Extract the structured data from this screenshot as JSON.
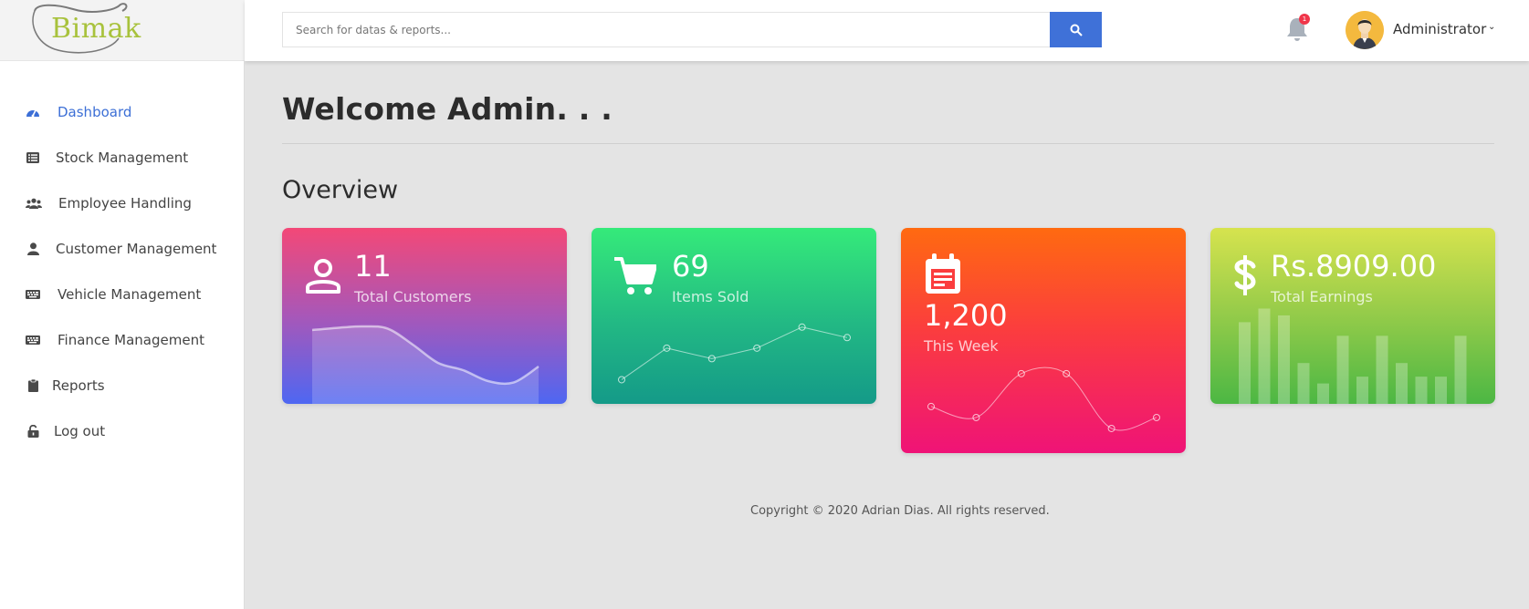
{
  "brand": {
    "logo_text": "Bimak"
  },
  "header": {
    "search_placeholder": "Search for datas & reports...",
    "notification_count": "1",
    "user_name": "Administrator"
  },
  "sidebar": {
    "items": [
      {
        "label": "Dashboard",
        "icon": "dashboard-icon",
        "active": true
      },
      {
        "label": "Stock Management",
        "icon": "list-icon",
        "active": false
      },
      {
        "label": "Employee Handling",
        "icon": "users-icon",
        "active": false
      },
      {
        "label": "Customer Management",
        "icon": "user-icon",
        "active": false
      },
      {
        "label": "Vehicle Management",
        "icon": "keyboard-icon",
        "active": false
      },
      {
        "label": "Finance Management",
        "icon": "keyboard-icon",
        "active": false
      },
      {
        "label": "Reports",
        "icon": "clipboard-icon",
        "active": false
      },
      {
        "label": "Log out",
        "icon": "unlock-icon",
        "active": false
      }
    ]
  },
  "main": {
    "welcome": "Welcome Admin. . .",
    "overview": "Overview"
  },
  "cards": [
    {
      "value": "11",
      "label": "Total Customers",
      "icon": "user-icon",
      "colors": [
        "#f34877",
        "#4e67f2"
      ]
    },
    {
      "value": "69",
      "label": "Items Sold",
      "icon": "cart-icon",
      "colors": [
        "#35ea7a",
        "#149a88"
      ]
    },
    {
      "value": "1,200",
      "label": "This Week",
      "icon": "calendar-icon",
      "colors": [
        "#ff6a10",
        "#ef1377"
      ]
    },
    {
      "value": "Rs.8909.00",
      "label": "Total Earnings",
      "icon": "dollar-icon",
      "colors": [
        "#d6e34e",
        "#4cb744"
      ]
    }
  ],
  "chart_data": [
    {
      "type": "area",
      "series": [
        {
          "values": [
            8,
            8.3,
            8.5,
            8.2,
            6,
            3.5,
            2.5,
            1,
            0.8,
            3
          ]
        }
      ]
    },
    {
      "type": "line",
      "series": [
        {
          "values": [
            1,
            4,
            3,
            4,
            6,
            5
          ]
        }
      ]
    },
    {
      "type": "line",
      "series": [
        {
          "values": [
            3,
            2,
            6,
            6,
            1,
            2
          ]
        }
      ]
    },
    {
      "type": "bar",
      "series": [
        {
          "values": [
            6,
            7,
            6.5,
            3,
            1.5,
            5,
            2,
            5,
            3,
            2,
            2,
            5
          ]
        }
      ]
    }
  ],
  "footer": {
    "copyright": "Copyright © 2020 Adrian Dias. All rights reserved."
  }
}
